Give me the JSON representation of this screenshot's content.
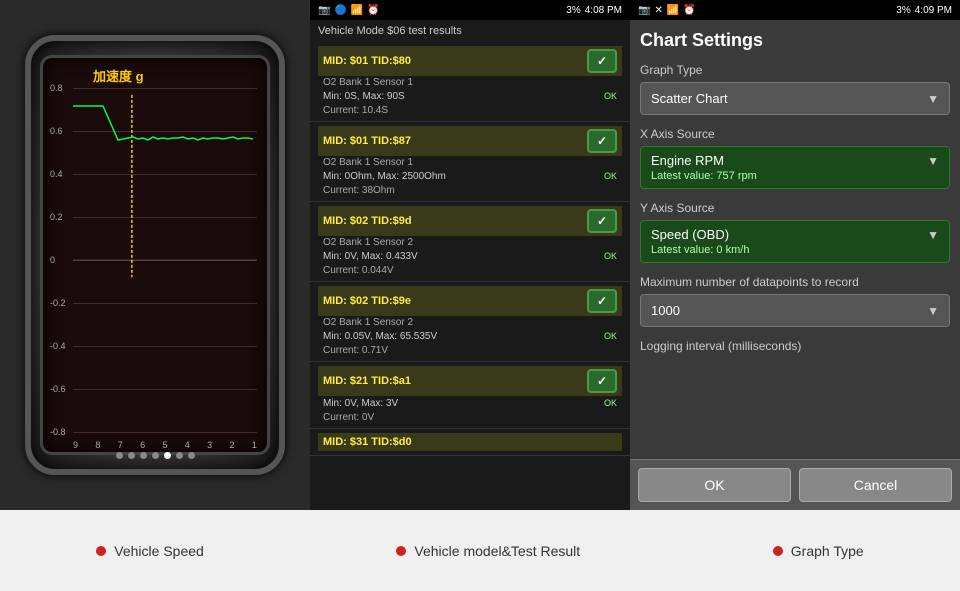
{
  "panel1": {
    "title": "加速度 g",
    "y_labels": [
      "0.8",
      "0.6",
      "0.4",
      "0.2",
      "0",
      "-0.2",
      "-0.4",
      "-0.6",
      "-0.8"
    ],
    "x_labels": [
      "9",
      "8",
      "7",
      "6",
      "5",
      "4",
      "3",
      "2",
      "1"
    ]
  },
  "panel2": {
    "status_bar": {
      "time": "4:08 PM",
      "battery": "3%"
    },
    "header_title": "Vehicle Mode $06 test results",
    "items": [
      {
        "mid_tid": "MID: $01 TID:$80",
        "sensor": "O2 Bank 1 Sensor 1",
        "detail": "Min: 0S, Max: 90S",
        "current": "Current: 10.4S",
        "status": "OK"
      },
      {
        "mid_tid": "MID: $01 TID:$87",
        "sensor": "O2 Bank 1 Sensor 1",
        "detail": "Min: 0Ohm, Max: 2500Ohm",
        "current": "Current: 38Ohm",
        "status": "OK"
      },
      {
        "mid_tid": "MID: $02 TID:$9d",
        "sensor": "O2 Bank 1 Sensor 2",
        "detail": "Min: 0V, Max: 0.433V",
        "current": "Current: 0.044V",
        "status": "OK"
      },
      {
        "mid_tid": "MID: $02 TID:$9e",
        "sensor": "O2 Bank 1 Sensor 2",
        "detail": "Min: 0.05V, Max: 65.535V",
        "current": "Current: 0.71V",
        "status": "OK"
      },
      {
        "mid_tid": "MID: $21 TID:$a1",
        "sensor": "",
        "detail": "Min: 0V, Max: 3V",
        "current": "Current: 0V",
        "status": "OK"
      },
      {
        "mid_tid": "MID: $31 TID:$d0",
        "sensor": "",
        "detail": "",
        "current": "",
        "status": ""
      }
    ]
  },
  "panel3": {
    "status_bar": {
      "time": "4:09 PM",
      "battery": "3%"
    },
    "title": "Chart Settings",
    "graph_type_label": "Graph Type",
    "graph_type_value": "Scatter Chart",
    "x_axis_label": "X Axis Source",
    "x_axis_value": "Engine RPM",
    "x_axis_latest": "Latest value: 757 rpm",
    "y_axis_label": "Y Axis Source",
    "y_axis_value": "Speed (OBD)",
    "y_axis_latest": "Latest value: 0 km/h",
    "max_datapoints_label": "Maximum number of datapoints to record",
    "max_datapoints_value": "1000",
    "logging_label": "Logging interval (milliseconds)",
    "logging_value": "",
    "ok_label": "OK",
    "cancel_label": "Cancel"
  },
  "bottom": {
    "label1": "Vehicle Speed",
    "label2": "Vehicle model&Test Result",
    "label3": "Graph Type"
  }
}
